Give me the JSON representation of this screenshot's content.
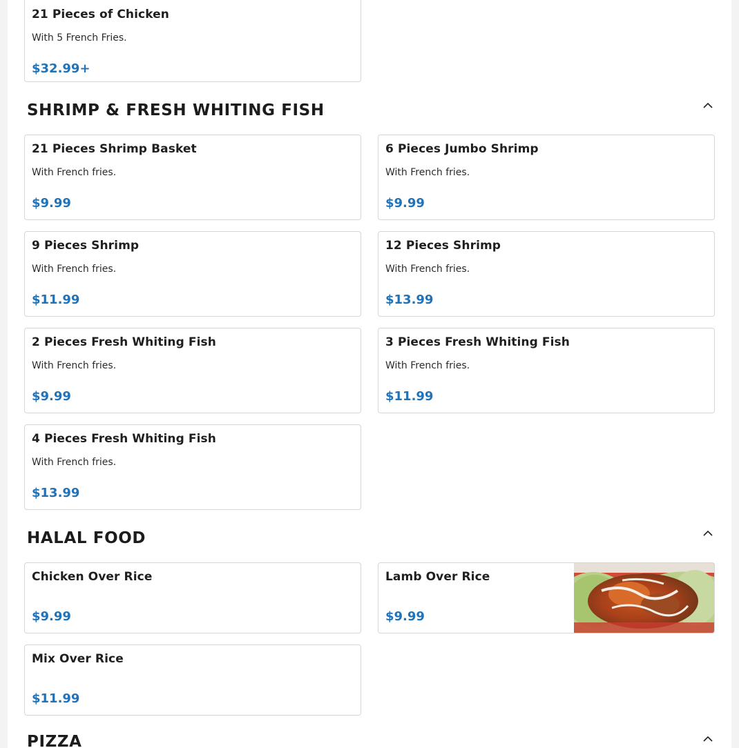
{
  "chicken_tail": {
    "item": {
      "name": "21 Pieces of Chicken",
      "desc": "With 5 French Fries.",
      "price": "$32.99+"
    }
  },
  "sections": [
    {
      "title": "SHRIMP & FRESH WHITING FISH",
      "toggle_icon": "chevron-up-icon",
      "items": [
        {
          "name": "21 Pieces Shrimp Basket",
          "desc": "With French fries.",
          "price": "$9.99"
        },
        {
          "name": "6 Pieces Jumbo Shrimp",
          "desc": "With French fries.",
          "price": "$9.99"
        },
        {
          "name": "9 Pieces Shrimp",
          "desc": "With French fries.",
          "price": "$11.99"
        },
        {
          "name": "12 Pieces Shrimp",
          "desc": "With French fries.",
          "price": "$13.99"
        },
        {
          "name": "2 Pieces Fresh Whiting Fish",
          "desc": "With French fries.",
          "price": "$9.99"
        },
        {
          "name": "3 Pieces Fresh Whiting Fish",
          "desc": "With French fries.",
          "price": "$11.99"
        },
        {
          "name": "4 Pieces Fresh Whiting Fish",
          "desc": "With French fries.",
          "price": "$13.99"
        }
      ]
    },
    {
      "title": "HALAL FOOD",
      "toggle_icon": "chevron-up-icon",
      "items": [
        {
          "name": "Chicken Over Rice",
          "price": "$9.99"
        },
        {
          "name": "Lamb Over Rice",
          "price": "$9.99",
          "image": "lamb-over-rice-photo"
        },
        {
          "name": "Mix Over Rice",
          "price": "$11.99"
        }
      ]
    },
    {
      "title": "PIZZA",
      "toggle_icon": "chevron-up-icon"
    }
  ],
  "colors": {
    "price": "#2272b8",
    "card_border": "#d6d6d6",
    "page_background": "#ffffff",
    "outer_background": "#f3f3f3"
  }
}
